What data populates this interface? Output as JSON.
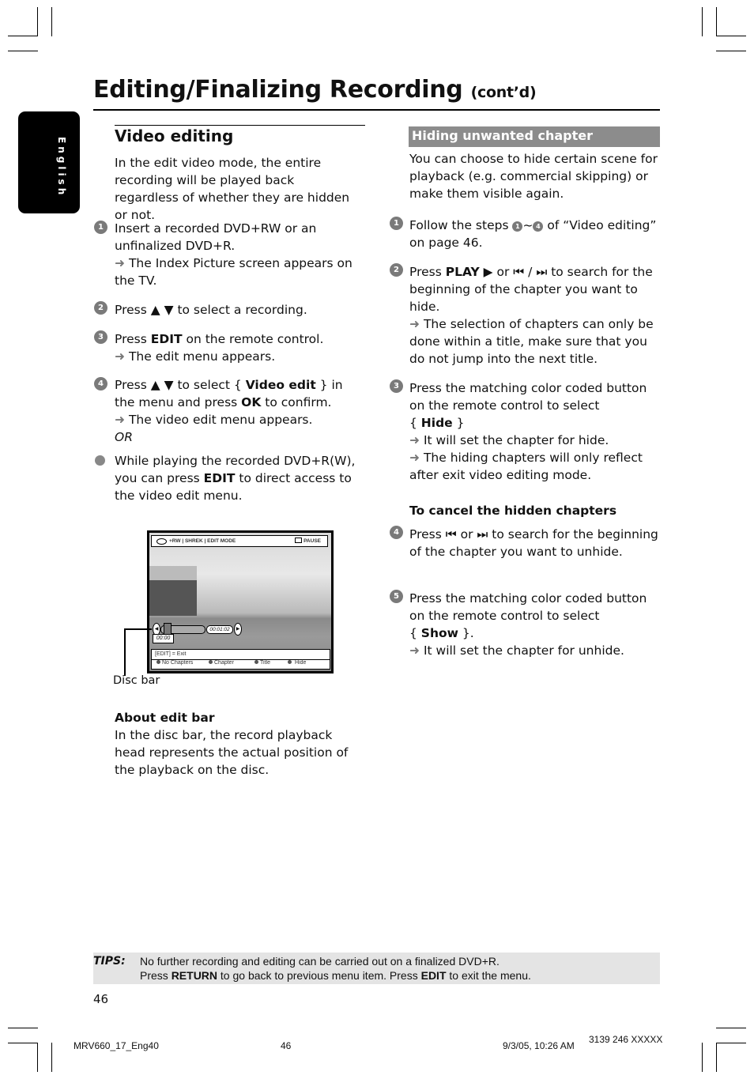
{
  "header": {
    "title": "Editing/Finalizing Recording",
    "title_suffix": "(cont’d)",
    "language_tab": "English"
  },
  "video_editing": {
    "title": "Video editing",
    "intro": "In the edit video mode, the entire recording will be played back regardless of whether they are hidden or not.",
    "steps": [
      {
        "num": "1",
        "text": "Insert a recorded DVD+RW or an unfinalized DVD+R.",
        "result": "The Index Picture screen appears on the TV."
      },
      {
        "num": "2",
        "pre": "Press ",
        "keys": "▲ ▼",
        "post": " to select a recording."
      },
      {
        "num": "3",
        "pre": "Press ",
        "bold": "EDIT",
        "post": " on the remote control.",
        "result": "The edit menu appears."
      },
      {
        "num": "4",
        "pre": "Press ",
        "keys": "▲ ▼",
        "mid": " to select { ",
        "bold": "Video edit",
        "mid2": " } in the menu and press ",
        "bold2": "OK",
        "post": " to confirm.",
        "result": "The video edit menu appears.",
        "or": "OR"
      },
      {
        "bullet": true,
        "pre": "While playing the recorded DVD+R(W), you can press ",
        "bold": "EDIT",
        "post": " to direct access to the video edit menu."
      }
    ]
  },
  "screen": {
    "osd_title": "+RW | SHREK | EDIT MODE",
    "osd_status": "PAUSE",
    "time_start": "00:00",
    "time_end": "00:01:02",
    "exit_hint": "[EDIT] = Exit",
    "options": [
      "No Chapters",
      "Chapter",
      "Title",
      "Hide"
    ],
    "callout_label": "Disc bar"
  },
  "about_edit_bar": {
    "title": "About edit bar",
    "text": "In the disc bar, the record playback head represents the actual position of the playback on the disc."
  },
  "hiding": {
    "title": "Hiding unwanted chapter",
    "intro": "You can choose to hide certain scene for playback (e.g. commercial skipping) or make them visible again.",
    "step1_pre": "Follow the steps ",
    "step1_range_start": "1",
    "step1_range_end": "4",
    "step1_post": " of “Video editing” on page 46.",
    "step2_pre": "Press ",
    "step2_bold": "PLAY",
    "step2_keys": "▶",
    "step2_mid": " or ⏮ / ⏭ to search for the beginning of the chapter you want to hide.",
    "step2_result": "The selection of chapters can only be done within a title, make sure that you do not jump into the next title.",
    "step3_text": "Press the matching color coded button on the remote control to select",
    "step3_bold": "Hide",
    "step3_result1": "It will set the chapter for hide.",
    "step3_result2": "The hiding chapters will only reflect after exit video editing mode.",
    "cancel_title": "To cancel the hidden chapters",
    "step4_text": "Press ⏮ or ⏭ to search for the beginning of the chapter you want to unhide.",
    "step5_text": "Press the matching color coded button on the remote control to select",
    "step5_bold": "Show",
    "step5_result": "It will set the chapter for unhide."
  },
  "tips": {
    "label": "TIPS:",
    "line1": "No further recording and editing can be carried out on a finalized DVD+R.",
    "line2_pre": "Press ",
    "line2_bold1": "RETURN",
    "line2_mid": " to go back to previous menu item.  Press ",
    "line2_bold2": "EDIT",
    "line2_post": " to exit the menu."
  },
  "page_number": "46",
  "footer": {
    "file": "MRV660_17_Eng40",
    "page": "46",
    "date": "9/3/05, 10:26 AM",
    "code": "3139 246 XXXXX"
  },
  "arrow_glyph": "➜"
}
